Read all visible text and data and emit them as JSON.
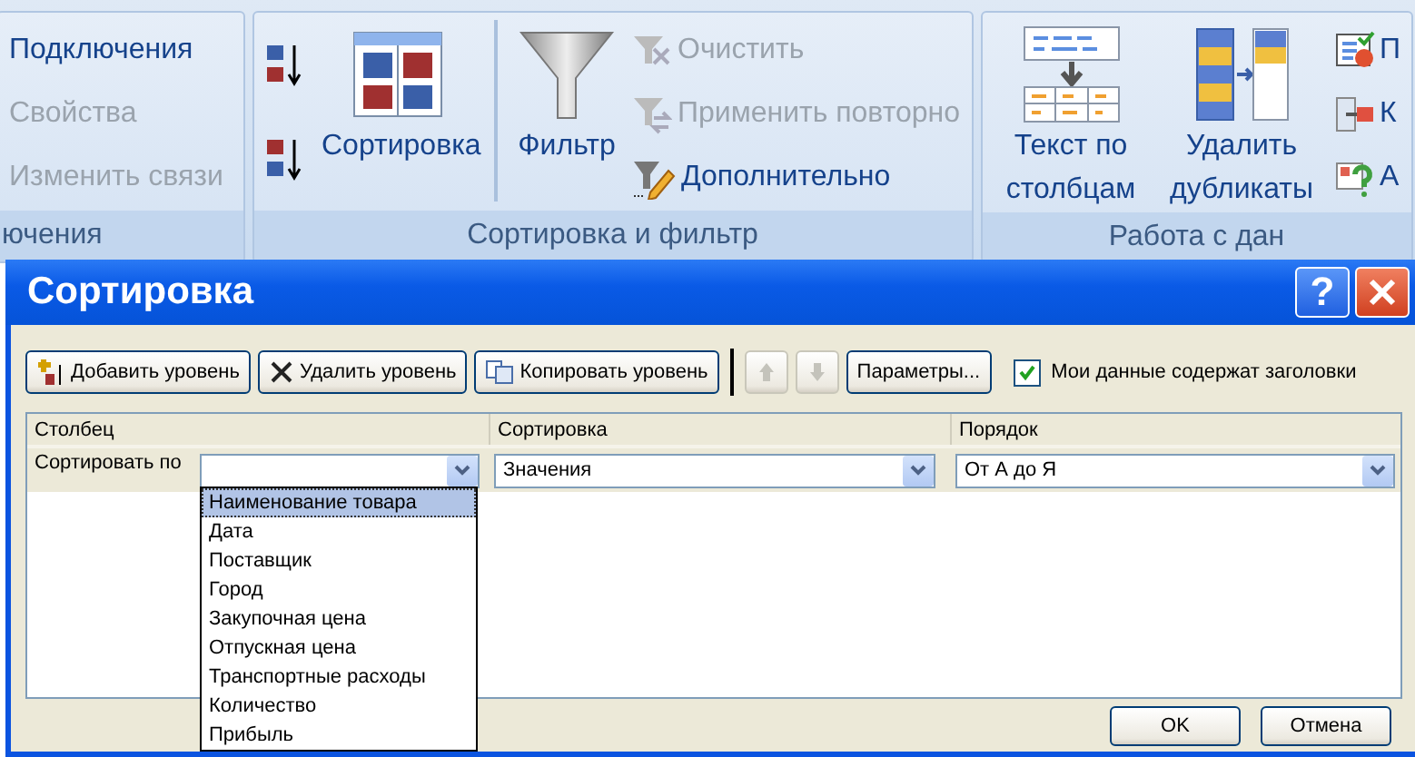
{
  "ribbon": {
    "groups": [
      {
        "label": "ючения",
        "items": [
          {
            "kind": "small",
            "label": "Подключения",
            "disabled": false
          },
          {
            "kind": "small",
            "label": "Свойства",
            "disabled": true
          },
          {
            "kind": "small",
            "label": "Изменить связи",
            "disabled": true
          }
        ]
      },
      {
        "label": "Сортировка и фильтр",
        "items": [
          {
            "kind": "icon",
            "disabled": false
          },
          {
            "kind": "icon",
            "disabled": false
          },
          {
            "kind": "large",
            "label": "Сортировка",
            "disabled": false
          },
          {
            "kind": "separator"
          },
          {
            "kind": "large",
            "label": "Фильтр",
            "disabled": false
          },
          {
            "kind": "small",
            "label": "Очистить",
            "disabled": true
          },
          {
            "kind": "small",
            "label": "Применить повторно",
            "disabled": true
          },
          {
            "kind": "small",
            "label": "Дополнительно",
            "disabled": false
          }
        ]
      },
      {
        "label": "Работа с дан",
        "items": [
          {
            "kind": "large",
            "label": "Текст по столбцам",
            "disabled": false
          },
          {
            "kind": "large",
            "label": "Удалить дубликаты",
            "disabled": false
          },
          {
            "kind": "small",
            "label": "П",
            "disabled": false
          },
          {
            "kind": "small",
            "label": "К",
            "disabled": false
          },
          {
            "kind": "small",
            "label": "А",
            "disabled": false
          }
        ]
      }
    ]
  },
  "dialog": {
    "title": "Сортировка",
    "help": "?",
    "toolbar": [
      {
        "kind": "button",
        "label": "Добавить уровень",
        "disabled": false
      },
      {
        "kind": "button",
        "label": "Удалить уровень",
        "disabled": false
      },
      {
        "kind": "button",
        "label": "Копировать уровень",
        "disabled": false
      },
      {
        "kind": "up",
        "disabled": true
      },
      {
        "kind": "down",
        "disabled": true
      },
      {
        "kind": "button",
        "label": "Параметры...",
        "disabled": false
      }
    ],
    "header_checkbox": {
      "label": "Мои данные содержат заголовки",
      "checked": true
    },
    "columns": [
      "Столбец",
      "Сортировка",
      "Порядок"
    ],
    "rows": [
      {
        "label": "Сортировать по",
        "sort_on": "Значения",
        "order": "От А до Я"
      }
    ],
    "dropdown": {
      "options": [
        {
          "label": "Наименование товара",
          "selected": true
        },
        {
          "label": "Дата",
          "selected": false
        },
        {
          "label": "Поставщик",
          "selected": false
        },
        {
          "label": "Город",
          "selected": false
        },
        {
          "label": "Закупочная цена",
          "selected": false
        },
        {
          "label": "Отпускная цена",
          "selected": false
        },
        {
          "label": "Транспортные расходы",
          "selected": false
        },
        {
          "label": "Количество",
          "selected": false
        },
        {
          "label": "Прибыль",
          "selected": false
        }
      ]
    },
    "buttons": [
      "OK",
      "Отмена"
    ]
  }
}
